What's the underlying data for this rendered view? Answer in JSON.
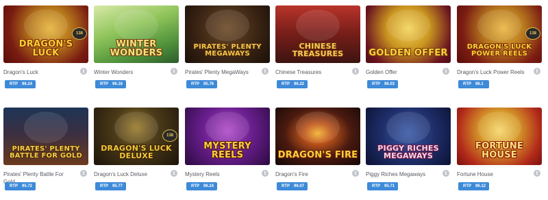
{
  "games": [
    {
      "name": "Dragon's Luck",
      "logo": "DRAGON'S LUCK",
      "rtp_label": "RTP",
      "rtp_value": "96.24",
      "theme": {
        "bg": "radial-gradient(circle at 55% 40%, #e7b43a 0%, #b5771b 35%, #7a1d12 70%, #5a0c0a 100%)",
        "text": "#f7cf35",
        "stroke": "#7a2a0a"
      },
      "badge": "138"
    },
    {
      "name": "Winter Wonders",
      "logo": "WINTER WONDERS",
      "rtp_label": "RTP",
      "rtp_value": "96.16",
      "theme": {
        "bg": "linear-gradient(160deg, #d8e9a8 0%, #8fc45a 40%, #4d8f3a 75%, #2d5c2c 100%)",
        "text": "#f8e27a",
        "stroke": "#6b3f12"
      }
    },
    {
      "name": "Pirates' Plenty MegaWays",
      "logo": "PIRATES' PLENTY MEGAWAYS",
      "rtp_label": "RTP",
      "rtp_value": "95.76",
      "theme": {
        "bg": "radial-gradient(circle at 50% 40%, #6d4a26 0%, #3a2414 55%, #1a0f08 100%)",
        "text": "#f1c54d",
        "stroke": "#4a2a0c"
      }
    },
    {
      "name": "Chinese Treasures",
      "logo": "CHINESE TREASURES",
      "rtp_label": "RTP",
      "rtp_value": "96.22",
      "theme": {
        "bg": "linear-gradient(180deg, #b8342a 0%, #7c1f1a 45%, #3c1410 100%)",
        "text": "#f6cf58",
        "stroke": "#6a2a0a"
      }
    },
    {
      "name": "Golden Offer",
      "logo": "GOLDEN OFFER",
      "rtp_label": "RTP",
      "rtp_value": "96.03",
      "theme": {
        "bg": "radial-gradient(circle at 50% 40%, #f4d35a 0%, #c9951f 40%, #6c1420 80%, #4a0c16 100%)",
        "text": "#f6d13e",
        "stroke": "#7a3a0a"
      }
    },
    {
      "name": "Dragon's Luck Power Reels",
      "logo": "DRAGON'S LUCK POWER REELS",
      "rtp_label": "RTP",
      "rtp_value": "96.1",
      "theme": {
        "bg": "radial-gradient(circle at 55% 40%, #eab640 0%, #b87a1e 35%, #7c1e13 70%, #5a0c0a 100%)",
        "text": "#f7cf35",
        "stroke": "#7a2a0a"
      },
      "badge": "138"
    },
    {
      "name": "Pirates' Plenty Battle For Gold",
      "logo": "PIRATES' PLENTY BATTLE FOR GOLD",
      "rtp_label": "RTP",
      "rtp_value": "95.72",
      "theme": {
        "bg": "linear-gradient(180deg, #1d3556 0%, #3b2f42 45%, #6b3a1e 100%)",
        "text": "#f4cc48",
        "stroke": "#4a2a0c"
      }
    },
    {
      "name": "Dragon's Luck Deluxe",
      "logo": "DRAGON'S LUCK DELUXE",
      "rtp_label": "RTP",
      "rtp_value": "95.77",
      "theme": {
        "bg": "radial-gradient(circle at 50% 35%, #9a7a2a 0%, #4a3a18 40%, #1c140a 100%)",
        "text": "#f2c83c",
        "stroke": "#3a2208"
      },
      "badge": "138"
    },
    {
      "name": "Mystery Reels",
      "logo": "MYSTERY REELS",
      "rtp_label": "RTP",
      "rtp_value": "96.24",
      "theme": {
        "bg": "radial-gradient(circle at 50% 40%, #b04ac8 0%, #6a1f8f 45%, #2c0a40 100%)",
        "text": "#f6d042",
        "stroke": "#5a1a0a"
      }
    },
    {
      "name": "Dragon's Fire",
      "logo": "DRAGON'S FIRE",
      "rtp_label": "RTP",
      "rtp_value": "96.07",
      "theme": {
        "bg": "radial-gradient(ellipse at 50% 45%, #f2b22c 0%, #c0561a 22%, #4a1a10 55%, #140806 100%)",
        "text": "#f8d23c",
        "stroke": "#6a2008"
      }
    },
    {
      "name": "Piggy Riches Megaways",
      "logo": "PIGGY RICHES MEGAWAYS",
      "rtp_label": "RTP",
      "rtp_value": "95.71",
      "theme": {
        "bg": "radial-gradient(circle at 50% 45%, #3a5aa8 0%, #1e2e6a 50%, #0c1234 100%)",
        "text": "#f6d6ea",
        "stroke": "#6a1a4a"
      }
    },
    {
      "name": "Fortune House",
      "logo": "FORTUNE HOUSE",
      "rtp_label": "RTP",
      "rtp_value": "96.12",
      "theme": {
        "bg": "radial-gradient(circle at 50% 40%, #f6d66a 0%, #d69a2a 35%, #b22a1a 75%, #7a1010 100%)",
        "text": "#fbe27a",
        "stroke": "#8a1a0a"
      }
    }
  ],
  "info_icon_glyph": "i"
}
